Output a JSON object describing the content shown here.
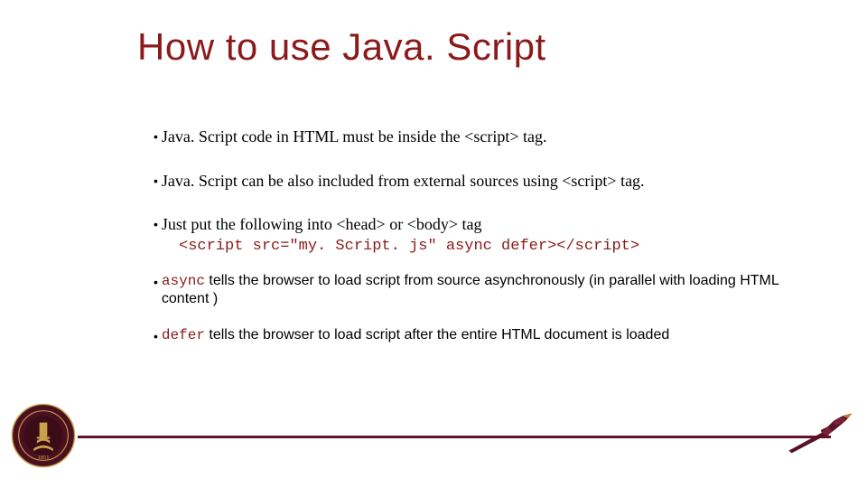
{
  "title": "How to use Java. Script",
  "bullets": {
    "b1": "Java. Script code in HTML must be inside the <script> tag.",
    "b2": "Java. Script can be also included from external sources using <script> tag.",
    "b3": "Just put the following into <head> or <body> tag",
    "code": "<script src=\"my. Script. js\" async defer></script>",
    "b4_kw": "async",
    "b4_rest": " tells the browser to load script from source asynchronously (in parallel with loading HTML content )",
    "b5_kw": "defer",
    "b5_rest": " tells the browser to load script after the entire HTML document is loaded"
  },
  "seal_year": "1851"
}
